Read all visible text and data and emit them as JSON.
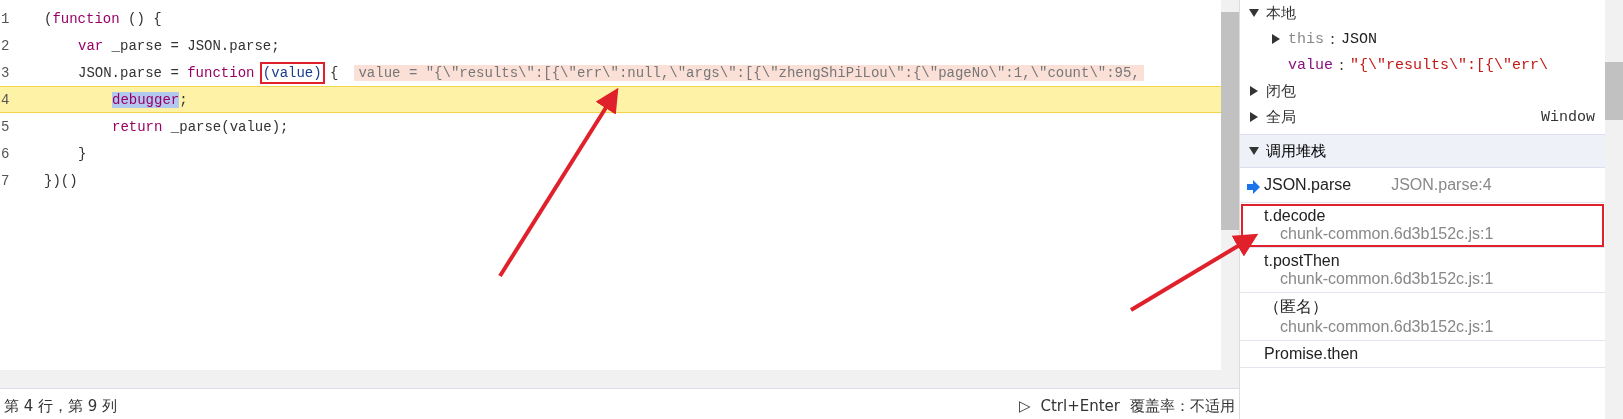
{
  "editor": {
    "lines": [
      {
        "number": "1",
        "paused": false,
        "kind": "top",
        "tokens": [
          {
            "kind": "punct",
            "text": "("
          },
          {
            "kind": "keyword",
            "text": "function"
          },
          {
            "kind": "punct",
            "text": " () {"
          }
        ]
      },
      {
        "number": "2",
        "paused": false,
        "kind": "body",
        "tokens": [
          {
            "kind": "keyword",
            "text": "var"
          },
          {
            "kind": "plain",
            "text": " _parse = JSON.parse;"
          }
        ]
      },
      {
        "number": "3",
        "paused": false,
        "kind": "body",
        "tokens": [
          {
            "kind": "plain",
            "text": "JSON.parse = "
          },
          {
            "kind": "keyword",
            "text": "function "
          },
          {
            "kind": "param",
            "text": "(value)",
            "annotated": true
          },
          {
            "kind": "punct",
            "text": " {"
          },
          {
            "kind": "inline-value",
            "text": "value = \"{\\\"results\\\":[{\\\"err\\\":null,\\\"args\\\":[{\\\"zhengShiPiLou\\\":{\\\"pageNo\\\":1,\\\"count\\\":95,"
          }
        ]
      },
      {
        "number": "4",
        "paused": true,
        "kind": "inner",
        "tokens": [
          {
            "kind": "selected-keyword",
            "text": "debugger"
          },
          {
            "kind": "punct",
            "text": ";"
          }
        ]
      },
      {
        "number": "5",
        "paused": false,
        "kind": "inner",
        "tokens": [
          {
            "kind": "keyword",
            "text": "return"
          },
          {
            "kind": "plain",
            "text": " _parse(value);"
          }
        ]
      },
      {
        "number": "6",
        "paused": false,
        "kind": "body",
        "tokens": [
          {
            "kind": "punct",
            "text": "}"
          }
        ]
      },
      {
        "number": "7",
        "paused": false,
        "kind": "top",
        "tokens": [
          {
            "kind": "punct",
            "text": "})()"
          }
        ]
      }
    ]
  },
  "status_bar": {
    "position": "第 4 行，第 9 列",
    "run_icon": "▷",
    "shortcut": "Ctrl+Enter",
    "coverage": "覆盖率：不适用"
  },
  "scope": {
    "sections": [
      {
        "label": "本地",
        "expanded": true,
        "items": [
          {
            "kind": "object",
            "name": "this",
            "separator": ":",
            "value": "JSON",
            "expanded": false
          },
          {
            "kind": "string",
            "name": "value",
            "separator": ":",
            "value": "\"{\\\"results\\\":[{\\\"err\\"
          }
        ]
      },
      {
        "label": "闭包",
        "expanded": false
      },
      {
        "label": "全局",
        "expanded": false,
        "value": "Window"
      }
    ]
  },
  "call_stack": {
    "title": "调用堆栈",
    "expanded": true,
    "frames": [
      {
        "name": "JSON.parse",
        "location": "JSON.parse:4",
        "selected": true,
        "annotated": false
      },
      {
        "name": "t.decode",
        "location": "chunk-common.6d3b152c.js:1",
        "selected": false,
        "annotated": true
      },
      {
        "name": "t.postThen",
        "location": "chunk-common.6d3b152c.js:1",
        "selected": false,
        "annotated": false
      },
      {
        "name": "（匿名）",
        "location": "chunk-common.6d3b152c.js:1",
        "selected": false,
        "annotated": false
      },
      {
        "name": "Promise.then",
        "selected": false,
        "annotated": false
      }
    ]
  }
}
